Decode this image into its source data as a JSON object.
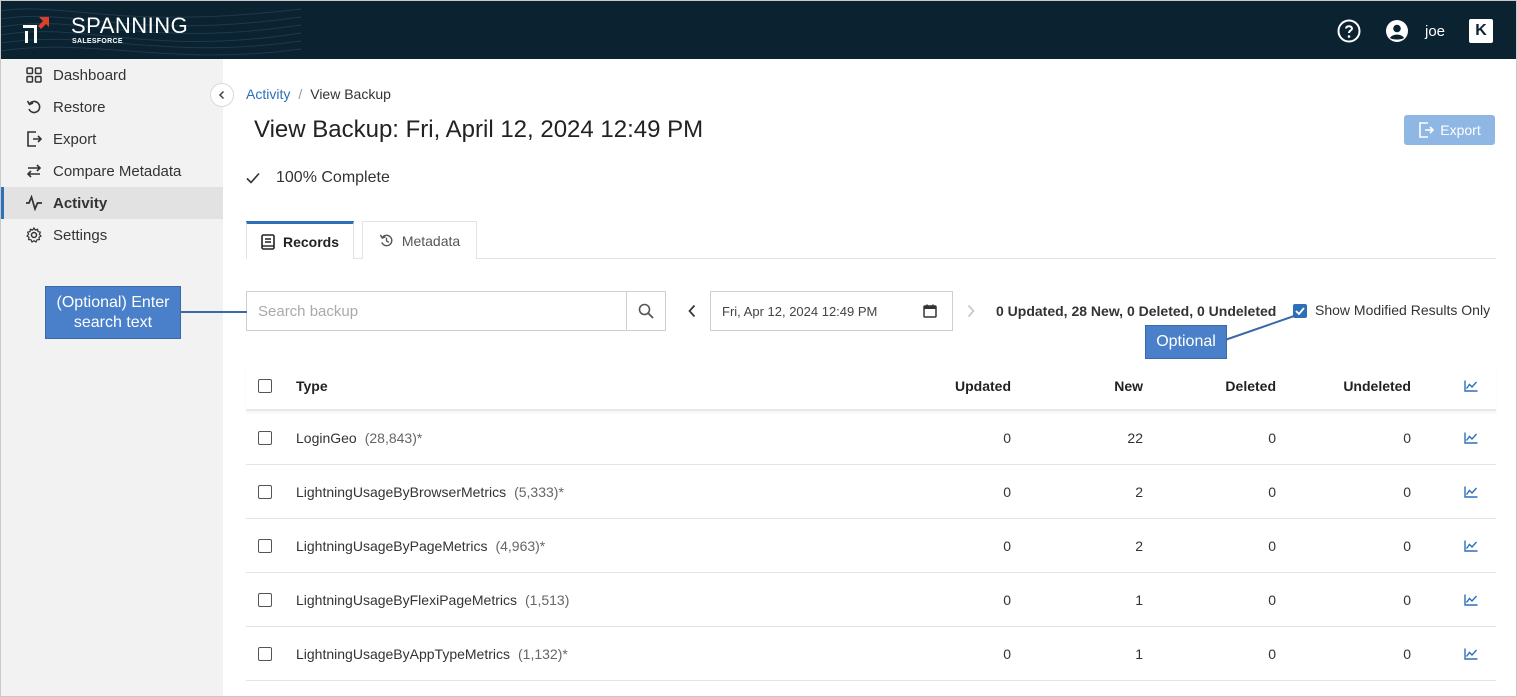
{
  "app": {
    "logo_text": "SPANNING",
    "logo_sub": "SALESFORCE"
  },
  "header": {
    "user_name": "joe",
    "brand_icon_text": "K"
  },
  "sidebar": {
    "items": [
      {
        "label": "Dashboard",
        "icon": "dashboard-icon"
      },
      {
        "label": "Restore",
        "icon": "restore-icon"
      },
      {
        "label": "Export",
        "icon": "export-icon"
      },
      {
        "label": "Compare Metadata",
        "icon": "compare-icon"
      },
      {
        "label": "Activity",
        "icon": "activity-icon",
        "active": true
      },
      {
        "label": "Settings",
        "icon": "settings-icon"
      }
    ]
  },
  "breadcrumb": {
    "parent": "Activity",
    "separator": "/",
    "current": "View Backup"
  },
  "page": {
    "title": "View Backup: Fri, April 12, 2024 12:49 PM",
    "export_label": "Export",
    "status": "100% Complete"
  },
  "tabs": [
    {
      "label": "Records",
      "active": true
    },
    {
      "label": "Metadata",
      "active": false
    }
  ],
  "toolbar": {
    "search_placeholder": "Search backup",
    "date_value": "Fri, Apr 12, 2024 12:49 PM",
    "summary": "0 Updated, 28 New, 0 Deleted, 0 Undeleted",
    "modified_label": "Show Modified Results Only",
    "modified_checked": true
  },
  "callouts": {
    "search_line1": "(Optional) Enter",
    "search_line2": "search text",
    "optional": "Optional"
  },
  "table": {
    "headers": {
      "type": "Type",
      "updated": "Updated",
      "new": "New",
      "deleted": "Deleted",
      "undeleted": "Undeleted"
    },
    "rows": [
      {
        "type": "LoginGeo",
        "count": "(28,843)*",
        "updated": "0",
        "new": "22",
        "deleted": "0",
        "undeleted": "0"
      },
      {
        "type": "LightningUsageByBrowserMetrics",
        "count": "(5,333)*",
        "updated": "0",
        "new": "2",
        "deleted": "0",
        "undeleted": "0"
      },
      {
        "type": "LightningUsageByPageMetrics",
        "count": "(4,963)*",
        "updated": "0",
        "new": "2",
        "deleted": "0",
        "undeleted": "0"
      },
      {
        "type": "LightningUsageByFlexiPageMetrics",
        "count": "(1,513)",
        "updated": "0",
        "new": "1",
        "deleted": "0",
        "undeleted": "0"
      },
      {
        "type": "LightningUsageByAppTypeMetrics",
        "count": "(1,132)*",
        "updated": "0",
        "new": "1",
        "deleted": "0",
        "undeleted": "0"
      }
    ]
  },
  "colors": {
    "topbar": "#0b2230",
    "accent": "#2d6fb8",
    "callout": "#4a7fc9",
    "export_button": "#8fb7e3"
  }
}
